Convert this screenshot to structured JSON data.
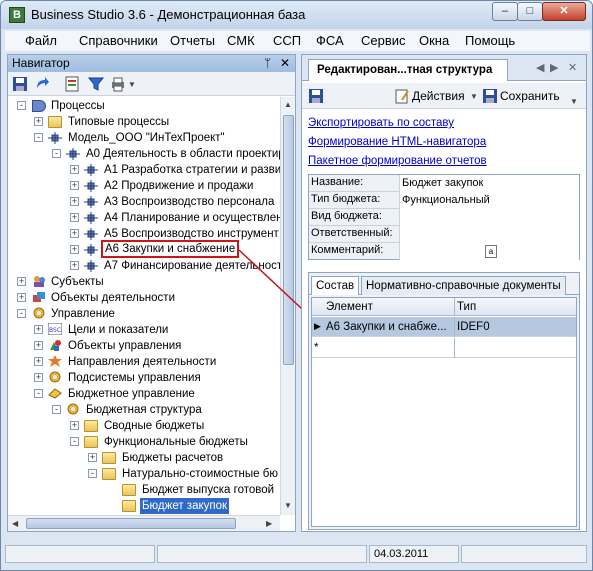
{
  "window": {
    "title": "Business Studio 3.6 - Демонстрационная база",
    "minimize": "–",
    "maximize": "□",
    "close": "✕"
  },
  "menu": [
    "Файл",
    "Справочники",
    "Отчеты",
    "СМК",
    "ССП",
    "ФСА",
    "Сервис",
    "Окна",
    "Помощь"
  ],
  "navigator": {
    "title": "Навигатор",
    "pin": "ᛘ",
    "close": "✕",
    "tree": [
      {
        "label": "Процессы",
        "icon": "process-icon",
        "exp": "-"
      },
      {
        "label": "Типовые процессы",
        "icon": "folder-icon",
        "exp": "+"
      },
      {
        "label": "Модель_ООО \"ИнТехПроект\"",
        "icon": "model-icon",
        "exp": "-"
      },
      {
        "label": "А0 Деятельность в области проектир",
        "icon": "process-node-icon",
        "exp": "-"
      },
      {
        "label": "А1 Разработка стратегии и разви",
        "icon": "process-node-icon",
        "exp": "+"
      },
      {
        "label": "А2 Продвижение и продажи",
        "icon": "process-node-icon",
        "exp": "+"
      },
      {
        "label": "А3 Воспроизводство персонала",
        "icon": "process-node-icon",
        "exp": "+"
      },
      {
        "label": "А4 Планирование и осуществлен",
        "icon": "process-node-icon",
        "exp": "+"
      },
      {
        "label": "А5 Воспроизводство инструмент",
        "icon": "process-node-icon",
        "exp": "+"
      },
      {
        "label": "А6 Закупки и снабжение",
        "icon": "process-node-icon",
        "exp": "+"
      },
      {
        "label": "А7 Финансирование деятельност",
        "icon": "process-node-icon",
        "exp": "+"
      },
      {
        "label": "Субъекты",
        "icon": "subjects-icon",
        "exp": "+"
      },
      {
        "label": "Объекты деятельности",
        "icon": "objects-icon",
        "exp": "+"
      },
      {
        "label": "Управление",
        "icon": "management-icon",
        "exp": "-"
      },
      {
        "label": "Цели и показатели",
        "icon": "bsc-icon",
        "exp": "+"
      },
      {
        "label": "Объекты управления",
        "icon": "shapes-icon",
        "exp": "+"
      },
      {
        "label": "Направления деятельности",
        "icon": "star-icon",
        "exp": "+"
      },
      {
        "label": "Подсистемы управления",
        "icon": "gear-icon",
        "exp": "+"
      },
      {
        "label": "Бюджетное управление",
        "icon": "budget-icon",
        "exp": "-"
      },
      {
        "label": "Бюджетная структура",
        "icon": "budget-structure-icon",
        "exp": "-"
      },
      {
        "label": "Сводные бюджеты",
        "icon": "folder-icon",
        "exp": "+"
      },
      {
        "label": "Функциональные бюджеты",
        "icon": "folder-icon",
        "exp": "-"
      },
      {
        "label": "Бюджеты расчетов",
        "icon": "folder-icon",
        "exp": "+"
      },
      {
        "label": "Натурально-стоимостные бю",
        "icon": "folder-icon",
        "exp": "-"
      },
      {
        "label": "Бюджет выпуска готовой",
        "icon": "folder-icon",
        "exp": ""
      },
      {
        "label": "Бюджет закупок",
        "icon": "folder-icon",
        "exp": ""
      }
    ]
  },
  "editor": {
    "tab": "Редактирован...тная структура",
    "actions": "Действия",
    "save": "Сохранить",
    "links": [
      "Экспортировать по составу",
      "Формирование HTML-навигатора",
      "Пакетное формирование отчетов"
    ],
    "fields": [
      {
        "label": "Название:",
        "value": "Бюджет закупок"
      },
      {
        "label": "Тип бюджета:",
        "value": "Функциональный"
      },
      {
        "label": "Вид бюджета:",
        "value": ""
      },
      {
        "label": "Ответственный:",
        "value": ""
      },
      {
        "label": "Комментарий:",
        "value": ""
      }
    ],
    "lower_tabs": [
      "Состав",
      "Нормативно-справочные документы"
    ],
    "grid": {
      "headers": [
        "Элемент",
        "Тип"
      ],
      "rows": [
        {
          "element": "А6 Закупки и снабже...",
          "type": "IDEF0"
        }
      ],
      "new_row_marker": "*"
    }
  },
  "status": {
    "date": "04.03.2011"
  }
}
